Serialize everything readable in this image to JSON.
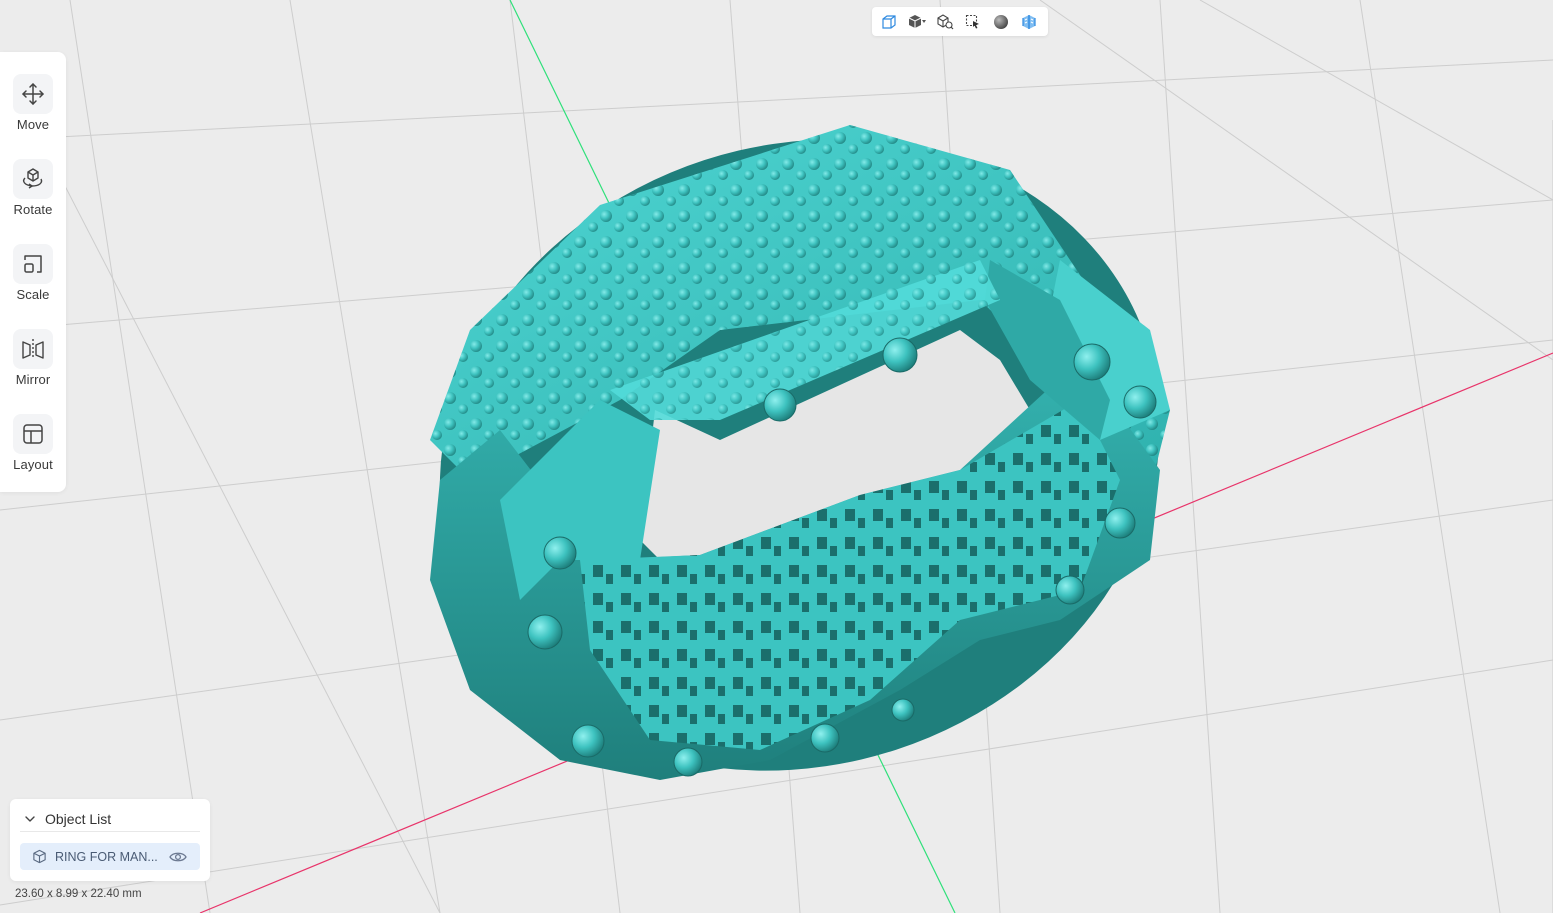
{
  "toolbar_icons": [
    {
      "name": "front-view-icon",
      "label": ""
    },
    {
      "name": "solid-shading-dropdown-icon",
      "label": ""
    },
    {
      "name": "zoom-to-fit-icon",
      "label": ""
    },
    {
      "name": "select-box-icon",
      "label": ""
    },
    {
      "name": "material-sphere-icon",
      "label": ""
    },
    {
      "name": "cross-section-icon",
      "label": ""
    }
  ],
  "tools": {
    "move": {
      "label": "Move",
      "icon": "move-arrows-icon"
    },
    "rotate": {
      "label": "Rotate",
      "icon": "rotate-cube-icon"
    },
    "scale": {
      "label": "Scale",
      "icon": "scale-box-icon"
    },
    "mirror": {
      "label": "Mirror",
      "icon": "mirror-icon"
    },
    "layout": {
      "label": "Layout",
      "icon": "layout-grid-icon"
    }
  },
  "object_list": {
    "title": "Object List",
    "items": [
      {
        "name": "RING FOR MAN...",
        "icon": "cube-icon",
        "visible": true
      }
    ]
  },
  "status": {
    "dimensions": "23.60 x 8.99 x 22.40 mm"
  },
  "colors": {
    "model": "#40c8c6",
    "model_dark": "#2a8f8c",
    "background": "#ececec",
    "grid_line": "#cfcfcf",
    "axis_x": "#e8346a",
    "axis_y": "#2fe07a",
    "accent": "#2f8ae0"
  }
}
